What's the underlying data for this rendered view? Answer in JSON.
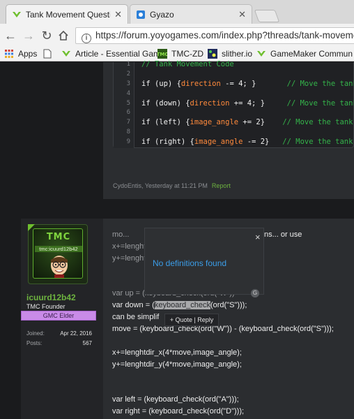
{
  "browser": {
    "tabs": [
      {
        "title": "Tank Movement Questio",
        "active": true
      },
      {
        "title": "Gyazo",
        "active": false
      }
    ],
    "url": "https://forum.yoyogames.com/index.php?threads/tank-movement",
    "bookmarks": [
      {
        "label": "Apps",
        "icon": "apps-grid-icon"
      },
      {
        "label": "",
        "icon": "document-icon"
      },
      {
        "label": "Article - Essential Gam",
        "icon": "yoyo-icon"
      },
      {
        "label": "TMC-ZD",
        "icon": "tmc-icon"
      },
      {
        "label": "slither.io",
        "icon": "slither-icon"
      },
      {
        "label": "GameMaker Commun",
        "icon": "yoyo-icon"
      }
    ]
  },
  "post1": {
    "code_lines": [
      {
        "num": "1",
        "parts": [
          {
            "t": "// Tank Movement Code",
            "c": "cmt"
          }
        ]
      },
      {
        "num": "2",
        "parts": []
      },
      {
        "num": "3",
        "parts": [
          {
            "t": "if (up) {",
            "c": "kw"
          },
          {
            "t": "direction",
            "c": "var"
          },
          {
            "t": " -= 4; }",
            "c": "kw"
          },
          {
            "t": "       // Move the tank Up",
            "c": "cmt"
          }
        ]
      },
      {
        "num": "4",
        "parts": []
      },
      {
        "num": "5",
        "parts": [
          {
            "t": "if (down) {",
            "c": "kw"
          },
          {
            "t": "direction",
            "c": "var"
          },
          {
            "t": " += 4; }",
            "c": "kw"
          },
          {
            "t": "     // Move the tank Do",
            "c": "cmt"
          }
        ]
      },
      {
        "num": "6",
        "parts": []
      },
      {
        "num": "7",
        "parts": [
          {
            "t": "if (left) {",
            "c": "kw"
          },
          {
            "t": "image_angle",
            "c": "var"
          },
          {
            "t": " += 2}",
            "c": "kw"
          },
          {
            "t": "    // Move the tank Le",
            "c": "cmt"
          }
        ]
      },
      {
        "num": "8",
        "parts": []
      },
      {
        "num": "9",
        "parts": [
          {
            "t": "if (right) {",
            "c": "kw"
          },
          {
            "t": "image_angle",
            "c": "var"
          },
          {
            "t": " -= 2}",
            "c": "kw"
          },
          {
            "t": "   // Move the tank Ri",
            "c": "cmt"
          }
        ]
      }
    ],
    "meta": "CydoEntis, Yesterday at 11:21 PM",
    "report": "Report"
  },
  "post2": {
    "user": {
      "avatar_logo": "TMC",
      "avatar_name": "tmc:icuurd12b42",
      "username": "icuurd12b42",
      "title": "TMC Founder",
      "rank": "GMC Elder",
      "joined_label": "Joined:",
      "joined_value": "Apr 22, 2016",
      "posts_label": "Posts:",
      "posts_value": "567"
    },
    "lines": {
      "l1": "mo...",
      "l1b": "ns... or use",
      "l2": "x+=lenghtdir_x(",
      "l3": "y+=lenghtdir_",
      "l4": "var up = (keyboard_check(ord(\"W\"))",
      "l5a": "var down = (",
      "l5b": "keyboard_check",
      "l5c": "(ord(\"S\")));",
      "l6": "can be simplif",
      "l7": "move = (keyboard_check(ord(\"W\")) - (keyboard_check(ord(\"S\")));",
      "l8": "x+=lenghtdir_x(4*move,image_angle);",
      "l9": "y+=lenghtdir_y(4*move,image_angle);",
      "l10": "var left = (keyboard_check(ord(\"A\")));",
      "l11": "var right = (keyboard_check(ord(\"D\")));"
    },
    "dictionary": {
      "message": "No definitions found",
      "close": "×"
    },
    "quote_popup": "+ Quote | Reply"
  },
  "colors": {
    "accent_green": "#6db33f",
    "link_blue": "#3b9de8",
    "rank_purple": "#c98be8"
  }
}
